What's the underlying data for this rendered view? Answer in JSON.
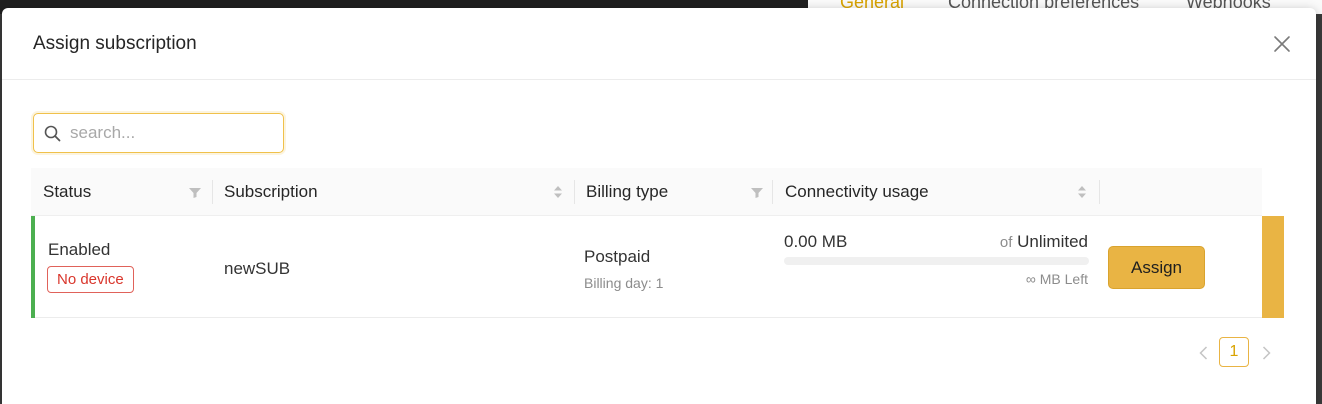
{
  "background": {
    "tabs": [
      {
        "label": "General",
        "active": true
      },
      {
        "label": "Connection preferences",
        "active": false
      },
      {
        "label": "Webhooks",
        "active": false
      }
    ]
  },
  "modal": {
    "title": "Assign subscription",
    "close_icon": "close-icon"
  },
  "search": {
    "placeholder": "search...",
    "value": "",
    "icon": "search-icon"
  },
  "table": {
    "columns": [
      {
        "label": "Status",
        "control": "filter-icon"
      },
      {
        "label": "Subscription",
        "control": "sort-icon"
      },
      {
        "label": "Billing type",
        "control": "filter-icon"
      },
      {
        "label": "Connectivity usage",
        "control": "sort-icon"
      }
    ],
    "rows": [
      {
        "status": "Enabled",
        "status_color": "#4caf50",
        "badge": "No device",
        "subscription": "newSUB",
        "billing_type": "Postpaid",
        "billing_day": "Billing day: 1",
        "usage_value": "0.00 MB",
        "usage_of_prefix": "of",
        "usage_limit": "Unlimited",
        "usage_left": "∞ MB Left",
        "usage_fraction": 0,
        "action_label": "Assign"
      }
    ]
  },
  "pagination": {
    "current_page": "1",
    "prev_icon": "chevron-left-icon",
    "next_icon": "chevron-right-icon"
  },
  "colors": {
    "accent": "#e9b444",
    "status_enabled": "#4caf50",
    "badge_red": "#d9362c"
  }
}
